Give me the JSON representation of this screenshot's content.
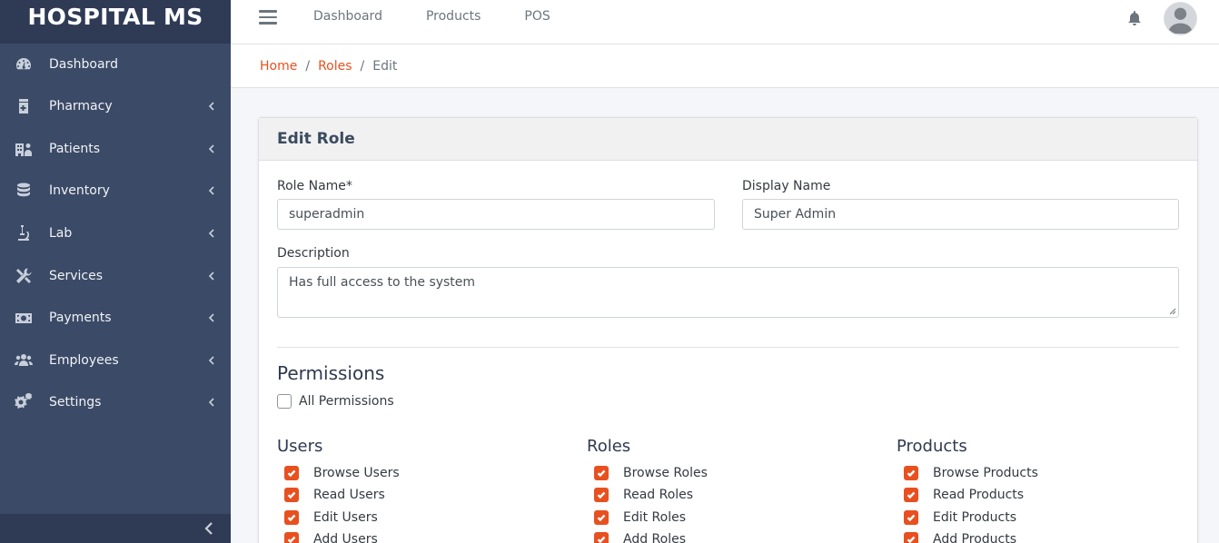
{
  "sidebar": {
    "brand": "HOSPITAL MS",
    "items": [
      {
        "label": "Dashboard",
        "icon": "dashboard-gauge-icon",
        "has_children": false
      },
      {
        "label": "Pharmacy",
        "icon": "pharmacy-icon",
        "has_children": true
      },
      {
        "label": "Patients",
        "icon": "hospital-user-icon",
        "has_children": true
      },
      {
        "label": "Inventory",
        "icon": "database-icon",
        "has_children": true
      },
      {
        "label": "Lab",
        "icon": "microscope-icon",
        "has_children": true
      },
      {
        "label": "Services",
        "icon": "tools-icon",
        "has_children": true
      },
      {
        "label": "Payments",
        "icon": "money-bill-icon",
        "has_children": true
      },
      {
        "label": "Employees",
        "icon": "users-icon",
        "has_children": true
      },
      {
        "label": "Settings",
        "icon": "cogs-icon",
        "has_children": true
      }
    ],
    "collapse_icon": "chevron-left-icon"
  },
  "topbar": {
    "links": [
      "Dashboard",
      "Products",
      "POS"
    ],
    "icons": [
      "hamburger-menu-icon",
      "bell-icon",
      "user-avatar"
    ]
  },
  "breadcrumb": {
    "home": "Home",
    "roles": "Roles",
    "current": "Edit"
  },
  "card": {
    "title": "Edit Role"
  },
  "form": {
    "role_name_label": "Role Name*",
    "role_name_value": "superadmin",
    "display_name_label": "Display Name",
    "display_name_value": "Super Admin",
    "description_label": "Description",
    "description_value": "Has full access to the system"
  },
  "permissions": {
    "heading": "Permissions",
    "all_label": "All Permissions",
    "all_checked": false,
    "groups": [
      {
        "title": "Users",
        "items": [
          {
            "label": "Browse Users",
            "checked": true
          },
          {
            "label": "Read Users",
            "checked": true
          },
          {
            "label": "Edit Users",
            "checked": true
          },
          {
            "label": "Add Users",
            "checked": true
          }
        ]
      },
      {
        "title": "Roles",
        "items": [
          {
            "label": "Browse Roles",
            "checked": true
          },
          {
            "label": "Read Roles",
            "checked": true
          },
          {
            "label": "Edit Roles",
            "checked": true
          },
          {
            "label": "Add Roles",
            "checked": true
          }
        ]
      },
      {
        "title": "Products",
        "items": [
          {
            "label": "Browse Products",
            "checked": true
          },
          {
            "label": "Read Products",
            "checked": true
          },
          {
            "label": "Edit Products",
            "checked": true
          },
          {
            "label": "Add Products",
            "checked": true
          }
        ]
      }
    ]
  },
  "colors": {
    "accent": "#e8501f",
    "sidebar": "#3b4a66",
    "sidebar_dark": "#2f3b55"
  }
}
